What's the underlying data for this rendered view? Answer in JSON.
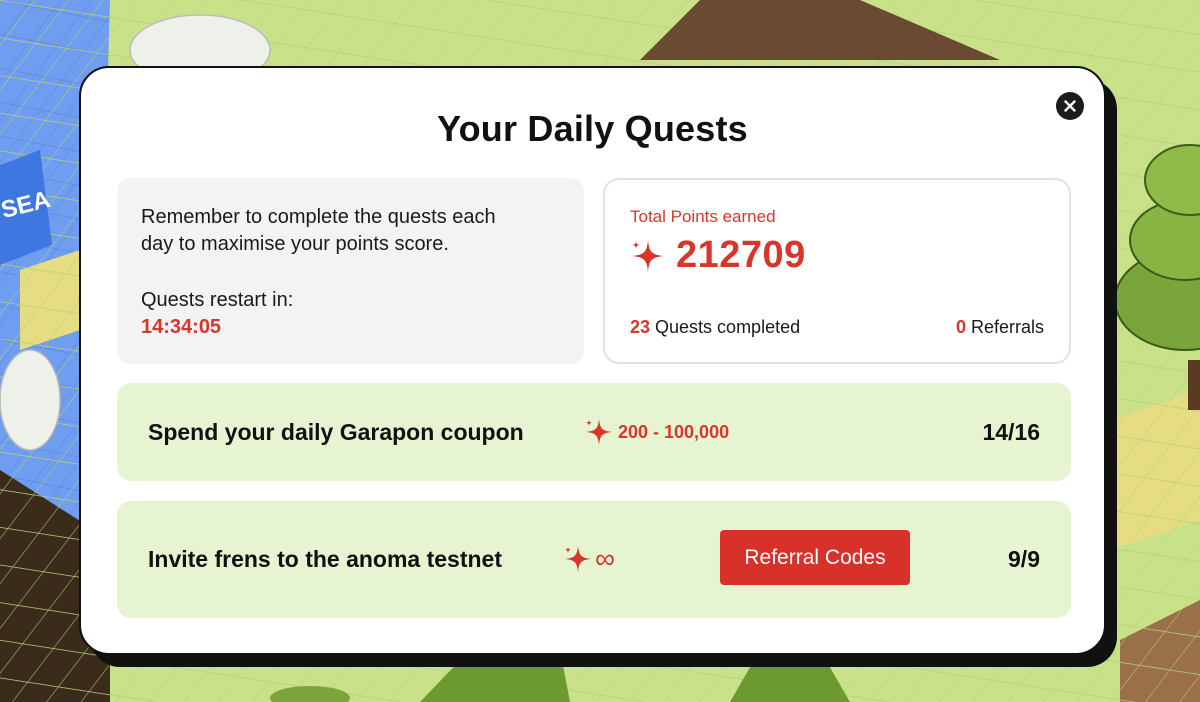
{
  "scene": {
    "sign_text": "SEA"
  },
  "modal": {
    "title": "Your Daily Quests",
    "close_icon": "close-icon"
  },
  "info": {
    "line1": "Remember to complete the quests each",
    "line2": "day to maximise your points score.",
    "restart_label": "Quests restart in:",
    "timer": "14:34:05"
  },
  "stats": {
    "label": "Total Points earned",
    "total": "212709",
    "quests_count": "23",
    "quests_label": " Quests completed",
    "referrals_count": "0",
    "referrals_label": " Referrals"
  },
  "quests": [
    {
      "title": "Spend your daily Garapon coupon",
      "reward": "200 - 100,000",
      "progress": "14/16"
    },
    {
      "title": "Invite frens to the anoma testnet",
      "reward": "∞",
      "progress": "9/9",
      "button_label": "Referral Codes"
    }
  ],
  "colors": {
    "accent": "#d8352b",
    "quest_bg": "#e7f4d2",
    "grass": "#c9e28a",
    "water": "#6f9df0"
  }
}
